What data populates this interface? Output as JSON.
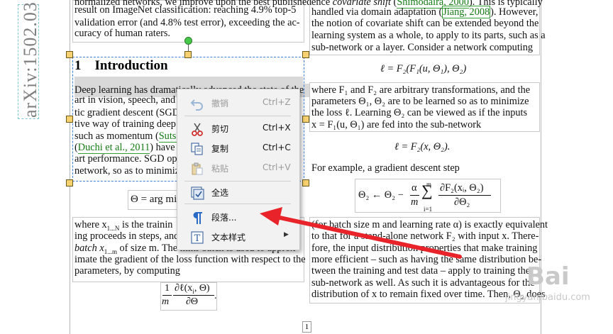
{
  "sidebar": {
    "arxiv_id": "arXiv:1502.03"
  },
  "left_column": {
    "top_text": [
      "normalized networks, we improve upon the best published",
      "result on ImageNet classification:  reaching 4.9% top-5",
      "validation error (and 4.8% test error), exceeding the ac-",
      "curacy of human raters."
    ],
    "heading": "1    Introduction",
    "intro_lines": [
      "Deep learning has dramatically advanced the state of the",
      "art in vision, speech, and",
      "tic gradient descent (SGD",
      "tive way of training deep",
      "such as momentum (Sutsk",
      "(Duchi et al., 2011) have b",
      "art performance.  SGD op",
      "network, so as to minimiz"
    ],
    "equation_fragment": "Θ = arg mi",
    "bottom_lines": [
      "where x",
      "ing proceeds in steps, and",
      "batch x",
      "imate the gradient of the loss function with respect to the",
      "parameters, by computing"
    ],
    "sub_1N": "1...N",
    "sub_1m": "1...m",
    "line1_rest": " is the trainin",
    "line3_rest": " of size m. The mini-batch is used to approx-",
    "frac_equation": {
      "num": "∂ℓ(x",
      "den": "∂Θ",
      "coef_num": "1",
      "coef_den": "m"
    }
  },
  "right_column": {
    "top_lines": [
      "ence covariate shift (Shimodaira, 2000). This is typically",
      "handled via domain adaptation (Jiang, 2008).  However,",
      "the notion of covariate shift can be extended beyond the",
      "learning system as a whole, to apply to its parts, such as a",
      "sub-network or a layer.  Consider a network computing"
    ],
    "eq1": "ℓ = F₂(F₁(u, Θ₁), Θ₂)",
    "mid_lines": [
      "where F₁ and F₂ are arbitrary transformations, and the",
      "parameters Θ₁, Θ₂ are to be learned so as to minimize",
      "the loss ℓ.  Learning Θ₂ can be viewed as if the inputs",
      "x = F₁(u, Θ₁) are fed into the sub-network"
    ],
    "eq2": "ℓ = F₂(x, Θ₂).",
    "example_line": "For example, a gradient descent step",
    "eq3": {
      "lhs": "Θ₂ ← Θ₂ −",
      "alpha": "α",
      "m": "m",
      "sum_top": "m",
      "sum_bot": "i=1",
      "num": "∂F₂(xᵢ, Θ₂)",
      "den": "∂Θ₂"
    },
    "bottom_lines": [
      "(for batch size m and learning rate α) is exactly equivalent",
      "to that for a stand-alone network F₂ with input x.  There-",
      "fore, the input distribution properties that make training",
      "more efficient – such as having the same distribution be-",
      "tween the training and test data – apply to training the",
      "sub-network as well.  As such it is advantageous for the",
      "distribution of x to remain fixed over time.  Then, Θ₂ does"
    ]
  },
  "context_menu": {
    "undo": {
      "label": "撤销",
      "shortcut": "Ctrl+Z"
    },
    "cut": {
      "label": "剪切",
      "shortcut": "Ctrl+X"
    },
    "copy": {
      "label": "复制",
      "shortcut": "Ctrl+C"
    },
    "paste": {
      "label": "粘贴",
      "shortcut": "Ctrl+V"
    },
    "select_all": {
      "label": "全选"
    },
    "paragraph": {
      "label": "段落..."
    },
    "text_style": {
      "label": "文本样式"
    }
  },
  "page_number": "1",
  "watermark": {
    "logo": "Bai",
    "url": "jingyan.baidu.com"
  },
  "colors": {
    "arrow": "#e8232a",
    "selection": "#3d7fd8",
    "handle": "#f8d270",
    "rotate": "#46c84a",
    "menu_bg": "#f2f2f2"
  }
}
